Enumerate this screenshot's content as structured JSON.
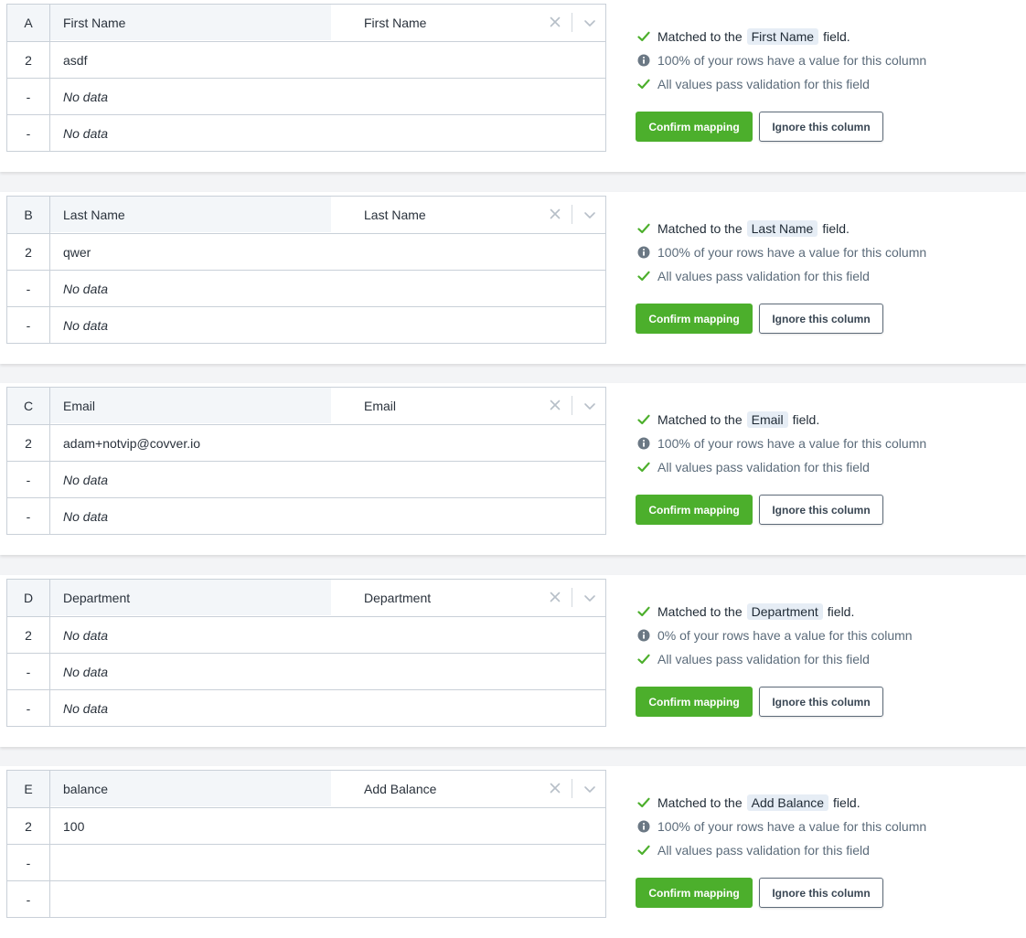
{
  "colors": {
    "accent": "#4caf2c",
    "check": "#4caf2c",
    "info": "#6b7884"
  },
  "columns": [
    {
      "letter": "A",
      "source": "First Name",
      "mapped": "First Name",
      "rows": [
        {
          "idx": "2",
          "val": "asdf",
          "empty": false
        },
        {
          "idx": "-",
          "val": "No data",
          "empty": true
        },
        {
          "idx": "-",
          "val": "No data",
          "empty": true
        }
      ],
      "matched_pre": "Matched to the",
      "field": "First Name",
      "matched_post": "field.",
      "coverage": "100% of your rows have a value for this column",
      "validation": "All values pass validation for this field",
      "confirm_label": "Confirm mapping",
      "ignore_label": "Ignore this column"
    },
    {
      "letter": "B",
      "source": "Last Name",
      "mapped": "Last Name",
      "rows": [
        {
          "idx": "2",
          "val": "qwer",
          "empty": false
        },
        {
          "idx": "-",
          "val": "No data",
          "empty": true
        },
        {
          "idx": "-",
          "val": "No data",
          "empty": true
        }
      ],
      "matched_pre": "Matched to the",
      "field": "Last Name",
      "matched_post": "field.",
      "coverage": "100% of your rows have a value for this column",
      "validation": "All values pass validation for this field",
      "confirm_label": "Confirm mapping",
      "ignore_label": "Ignore this column"
    },
    {
      "letter": "C",
      "source": "Email",
      "mapped": "Email",
      "rows": [
        {
          "idx": "2",
          "val": "adam+notvip@covver.io",
          "empty": false
        },
        {
          "idx": "-",
          "val": "No data",
          "empty": true
        },
        {
          "idx": "-",
          "val": "No data",
          "empty": true
        }
      ],
      "matched_pre": "Matched to the",
      "field": "Email",
      "matched_post": "field.",
      "coverage": "100% of your rows have a value for this column",
      "validation": "All values pass validation for this field",
      "confirm_label": "Confirm mapping",
      "ignore_label": "Ignore this column"
    },
    {
      "letter": "D",
      "source": "Department",
      "mapped": "Department",
      "rows": [
        {
          "idx": "2",
          "val": "No data",
          "empty": true
        },
        {
          "idx": "-",
          "val": "No data",
          "empty": true
        },
        {
          "idx": "-",
          "val": "No data",
          "empty": true
        }
      ],
      "matched_pre": "Matched to the",
      "field": "Department",
      "matched_post": "field.",
      "coverage": "0% of your rows have a value for this column",
      "validation": "All values pass validation for this field",
      "confirm_label": "Confirm mapping",
      "ignore_label": "Ignore this column"
    },
    {
      "letter": "E",
      "source": "balance",
      "mapped": "Add Balance",
      "rows": [
        {
          "idx": "2",
          "val": "100",
          "empty": false
        },
        {
          "idx": "-",
          "val": "",
          "empty": false
        },
        {
          "idx": "-",
          "val": "",
          "empty": false
        }
      ],
      "matched_pre": "Matched to the",
      "field": "Add Balance",
      "matched_post": "field.",
      "coverage": "100% of your rows have a value for this column",
      "validation": "All values pass validation for this field",
      "confirm_label": "Confirm mapping",
      "ignore_label": "Ignore this column"
    }
  ]
}
